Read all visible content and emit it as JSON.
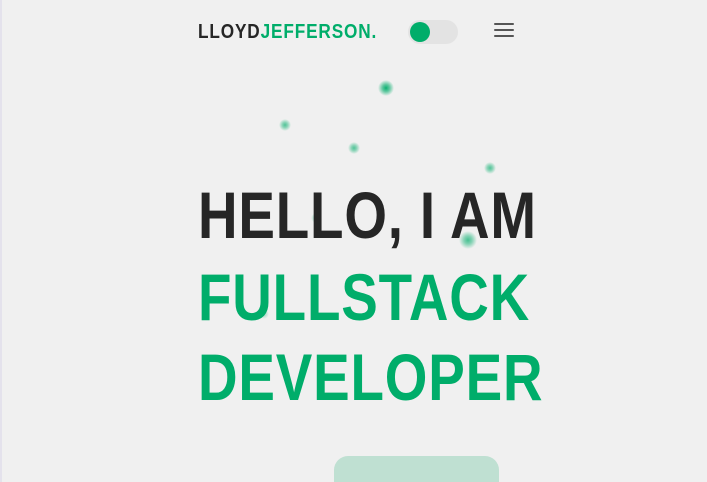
{
  "header": {
    "logo_first": "LLOYD",
    "logo_last": "JEFFERSON."
  },
  "theme_toggle": {
    "state": "on",
    "accent_color": "#00ad6a"
  },
  "menu": {
    "icon": "hamburger-menu-icon"
  },
  "hero": {
    "line1": "HELLO, I AM",
    "line2": "FULLSTACK",
    "line3": "DEVELOPER"
  },
  "colors": {
    "accent": "#00ad6a",
    "text_dark": "#262626",
    "background": "#f0f0f0"
  }
}
